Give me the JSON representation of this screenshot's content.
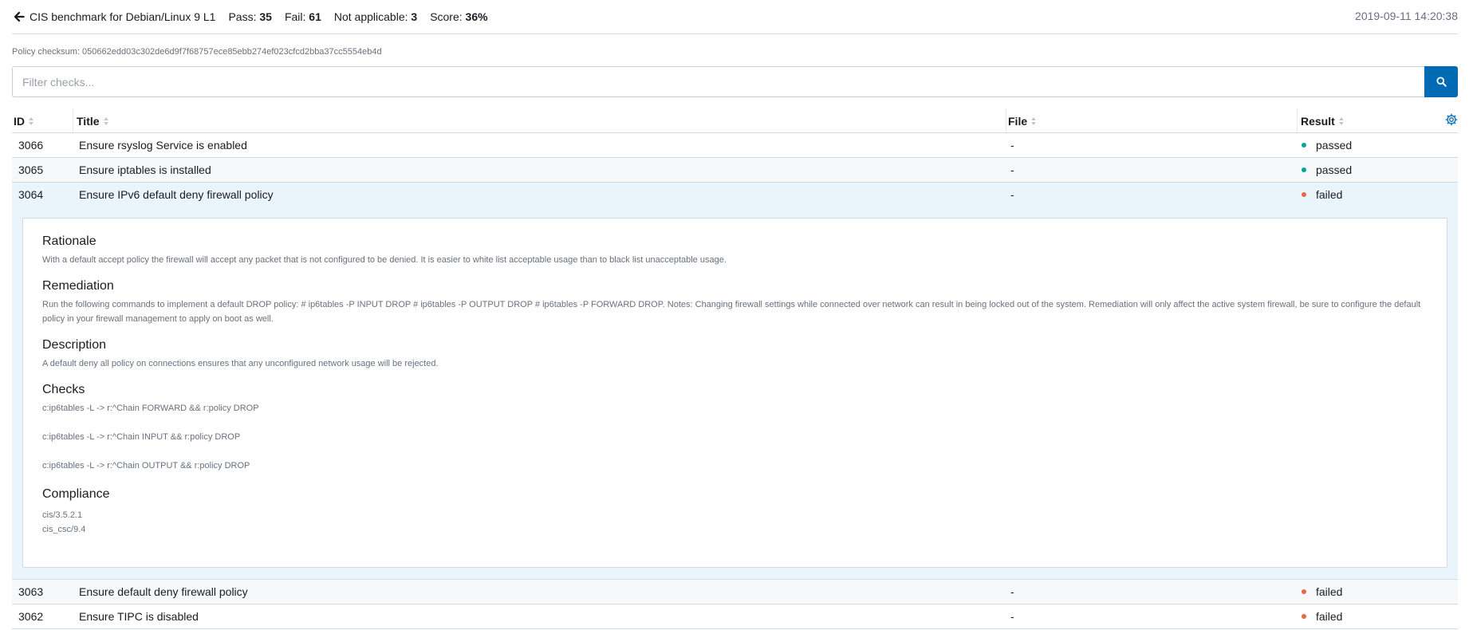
{
  "header": {
    "title": "CIS benchmark for Debian/Linux 9 L1",
    "pass_label": "Pass:",
    "pass_value": "35",
    "fail_label": "Fail:",
    "fail_value": "61",
    "na_label": "Not applicable:",
    "na_value": "3",
    "score_label": "Score:",
    "score_value": "36%",
    "timestamp": "2019-09-11 14:20:38"
  },
  "checksum": "Policy checksum: 050662edd03c302de6d9f7f68757ece85ebb274ef023cfcd2bba37cc5554eb4d",
  "search": {
    "placeholder": "Filter checks..."
  },
  "table": {
    "headers": {
      "id": "ID",
      "title": "Title",
      "file": "File",
      "result": "Result"
    },
    "rows": [
      {
        "id": "3066",
        "title": "Ensure rsyslog Service is enabled",
        "file": "-",
        "result": "passed"
      },
      {
        "id": "3065",
        "title": "Ensure iptables is installed",
        "file": "-",
        "result": "passed"
      },
      {
        "id": "3064",
        "title": "Ensure IPv6 default deny firewall policy",
        "file": "-",
        "result": "failed"
      },
      {
        "id": "3063",
        "title": "Ensure default deny firewall policy",
        "file": "-",
        "result": "failed"
      },
      {
        "id": "3062",
        "title": "Ensure TIPC is disabled",
        "file": "-",
        "result": "failed"
      }
    ]
  },
  "detail": {
    "rationale_heading": "Rationale",
    "rationale_text": "With a default accept policy the firewall will accept any packet that is not configured to be denied. It is easier to white list acceptable usage than to black list unacceptable usage.",
    "remediation_heading": "Remediation",
    "remediation_text": "Run the following commands to implement a default DROP policy: # ip6tables -P INPUT DROP # ip6tables -P OUTPUT DROP # ip6tables -P FORWARD DROP. Notes: Changing firewall settings while connected over network can result in being locked out of the system. Remediation will only affect the active system firewall, be sure to configure the default policy in your firewall management to apply on boot as well.",
    "description_heading": "Description",
    "description_text": "A default deny all policy on connections ensures that any unconfigured network usage will be rejected.",
    "checks_heading": "Checks",
    "checks": [
      "c:ip6tables -L -> r:^Chain FORWARD && r:policy DROP",
      "c:ip6tables -L -> r:^Chain INPUT && r:policy DROP",
      "c:ip6tables -L -> r:^Chain OUTPUT && r:policy DROP"
    ],
    "compliance_heading": "Compliance",
    "compliance": [
      "cis/3.5.2.1",
      "cis_csc/9.4"
    ]
  },
  "colors": {
    "passed": "#00a69b",
    "failed": "#e7664c",
    "accent": "#006bb4"
  },
  "icons": {
    "back": "arrow-left-icon",
    "search": "search-icon",
    "settings": "gear-icon",
    "sort": "sort-icon"
  }
}
